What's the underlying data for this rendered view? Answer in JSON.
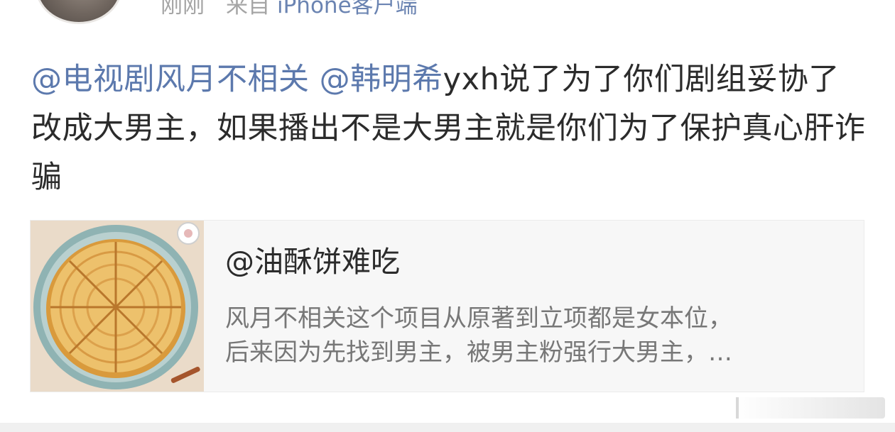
{
  "header": {
    "time_text": "刚刚",
    "source_prefix": "来自",
    "source_name": "iPhone客户端"
  },
  "post": {
    "mention_1": "@电视剧风月不相关",
    "mention_2": "@韩明希",
    "body": "yxh说了为了你们剧组妥协了改成大男主，如果播出不是大男主就是你们为了保护真心肝诈骗"
  },
  "quoted": {
    "username": "@油酥饼难吃",
    "text_line_1": "风月不相关这个项目从原著到立项都是女本位，",
    "text_line_2": "后来因为先找到男主，被男主粉强行大男主，…"
  },
  "icons": {
    "avatar": "avatar-image",
    "thumbnail": "pie-illustration"
  },
  "colors": {
    "mention": "#5c79ad",
    "source_link": "#6b84b2",
    "text": "#2b2b2b",
    "muted": "#a5a5a5",
    "card_bg": "#f7f7f7"
  }
}
